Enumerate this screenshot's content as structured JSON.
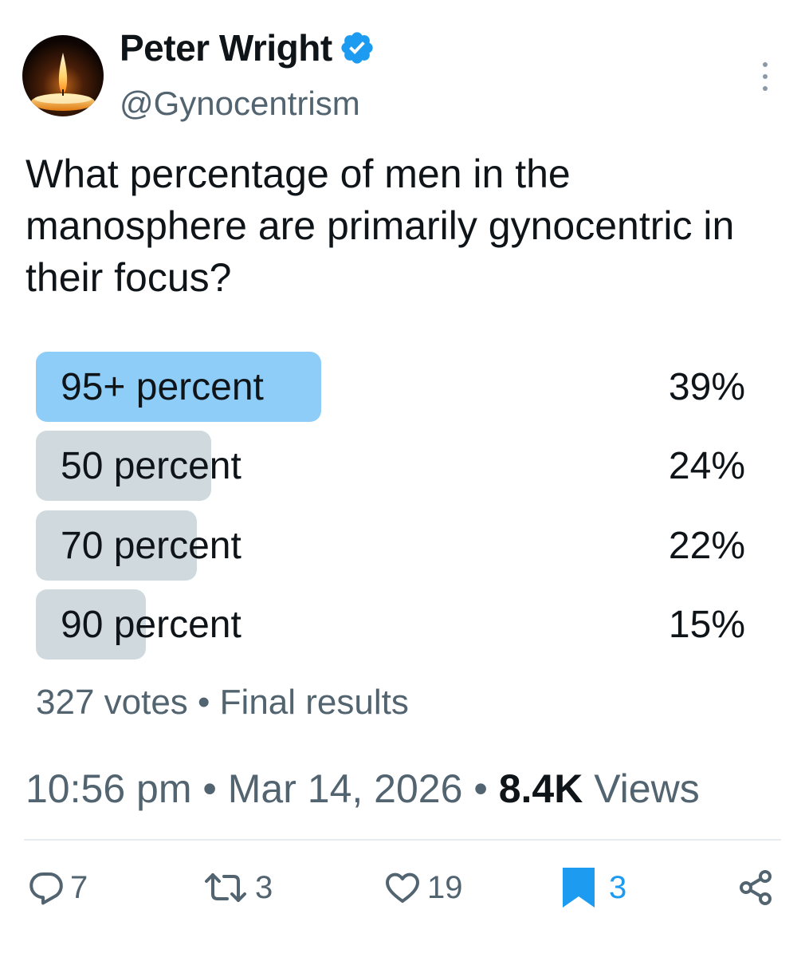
{
  "author": {
    "name": "Peter Wright",
    "handle": "@Gynocentrism",
    "verified_icon": "verified-badge-icon",
    "avatar_icon": "candle-flame-avatar"
  },
  "tweet": {
    "text": "What percentage of men in the manosphere are primarily gynocentric in their focus?"
  },
  "poll": {
    "options": [
      {
        "label": "95+ percent",
        "percent": "39%",
        "share": 0.39,
        "winner": true
      },
      {
        "label": "50 percent",
        "percent": "24%",
        "share": 0.24,
        "winner": false
      },
      {
        "label": "70 percent",
        "percent": "22%",
        "share": 0.22,
        "winner": false
      },
      {
        "label": "90 percent",
        "percent": "15%",
        "share": 0.15,
        "winner": false
      }
    ],
    "votes": "327 votes",
    "separator": " • ",
    "status": "Final results"
  },
  "meta": {
    "time": "10:56 pm",
    "date": "Mar 14, 2026",
    "separator": " • ",
    "views_count": "8.4K",
    "views_label": " Views"
  },
  "actions": {
    "replies": "7",
    "reposts": "3",
    "likes": "19",
    "bookmarks": "3"
  },
  "colors": {
    "accent": "#1d9bf0",
    "winner_fill": "#8ecdf8",
    "option_fill": "#cfd9de",
    "secondary_text": "#536471"
  }
}
